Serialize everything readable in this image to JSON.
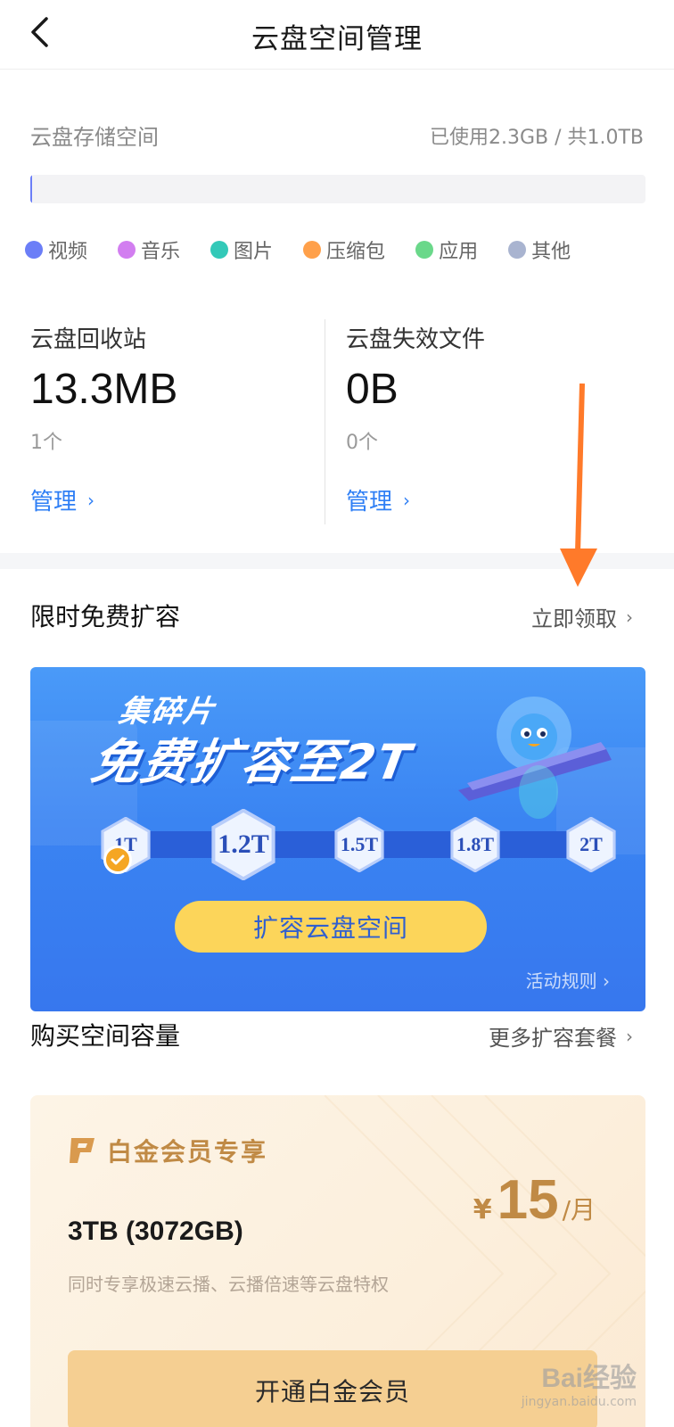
{
  "header": {
    "title": "云盘空间管理"
  },
  "storage": {
    "label": "云盘存储空间",
    "used_text": "已使用2.3GB / 共1.0TB",
    "used_fraction": 0.0022,
    "legend": [
      {
        "label": "视频",
        "color": "#6b7ef7"
      },
      {
        "label": "音乐",
        "color": "#d27ef0"
      },
      {
        "label": "图片",
        "color": "#33c9b8"
      },
      {
        "label": "压缩包",
        "color": "#ffa04a"
      },
      {
        "label": "应用",
        "color": "#6ad88a"
      },
      {
        "label": "其他",
        "color": "#a9b4d0"
      }
    ]
  },
  "recycle": {
    "title": "云盘回收站",
    "size": "13.3MB",
    "count": "1个",
    "link": "管理"
  },
  "invalid": {
    "title": "云盘失效文件",
    "size": "0B",
    "count": "0个",
    "link": "管理"
  },
  "free_expand": {
    "title": "限时免费扩容",
    "link": "立即领取",
    "banner": {
      "subtitle": "集碎片",
      "headline": "免费扩容至2T",
      "levels": [
        "1T",
        "1.2T",
        "1.5T",
        "1.8T",
        "2T"
      ],
      "button": "扩容云盘空间",
      "rules": "活动规则"
    }
  },
  "purchase": {
    "title": "购买空间容量",
    "link": "更多扩容套餐",
    "card": {
      "badge": "白金会员专享",
      "size": "3TB (3072GB)",
      "desc": "同时专享极速云播、云播倍速等云盘特权",
      "currency": "¥",
      "price": "15",
      "unit": "/月",
      "button": "开通白金会员"
    }
  },
  "watermark": {
    "main": "Bai经验",
    "sub": "jingyan.baidu.com"
  },
  "colors": {
    "link": "#2f7ff5",
    "accent_gold": "#c08a45",
    "arrow": "#ff7a2a"
  }
}
